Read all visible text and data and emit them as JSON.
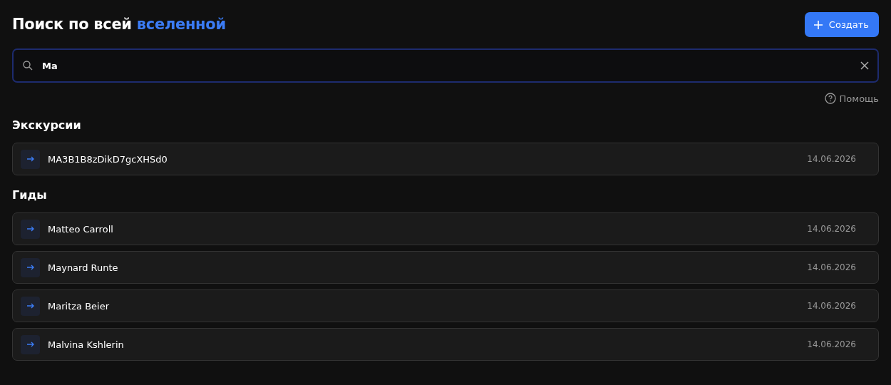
{
  "header": {
    "title": "Поиск по всей",
    "title_accent": "вселенной",
    "create_button": "Создать"
  },
  "search": {
    "value": "Ma"
  },
  "help_link": "Помощь",
  "sections": [
    {
      "title": "Экскурсии",
      "items": [
        {
          "name": "MA3B1B8zDikD7gcXHSd0",
          "date": "14.06.2026"
        }
      ]
    },
    {
      "title": "Гиды",
      "items": [
        {
          "name": "Matteo Carroll",
          "date": "14.06.2026"
        },
        {
          "name": "Maynard Runte",
          "date": "14.06.2026"
        },
        {
          "name": "Maritza Beier",
          "date": "14.06.2026"
        },
        {
          "name": "Malvina Kshlerin",
          "date": "14.06.2026"
        }
      ]
    }
  ]
}
